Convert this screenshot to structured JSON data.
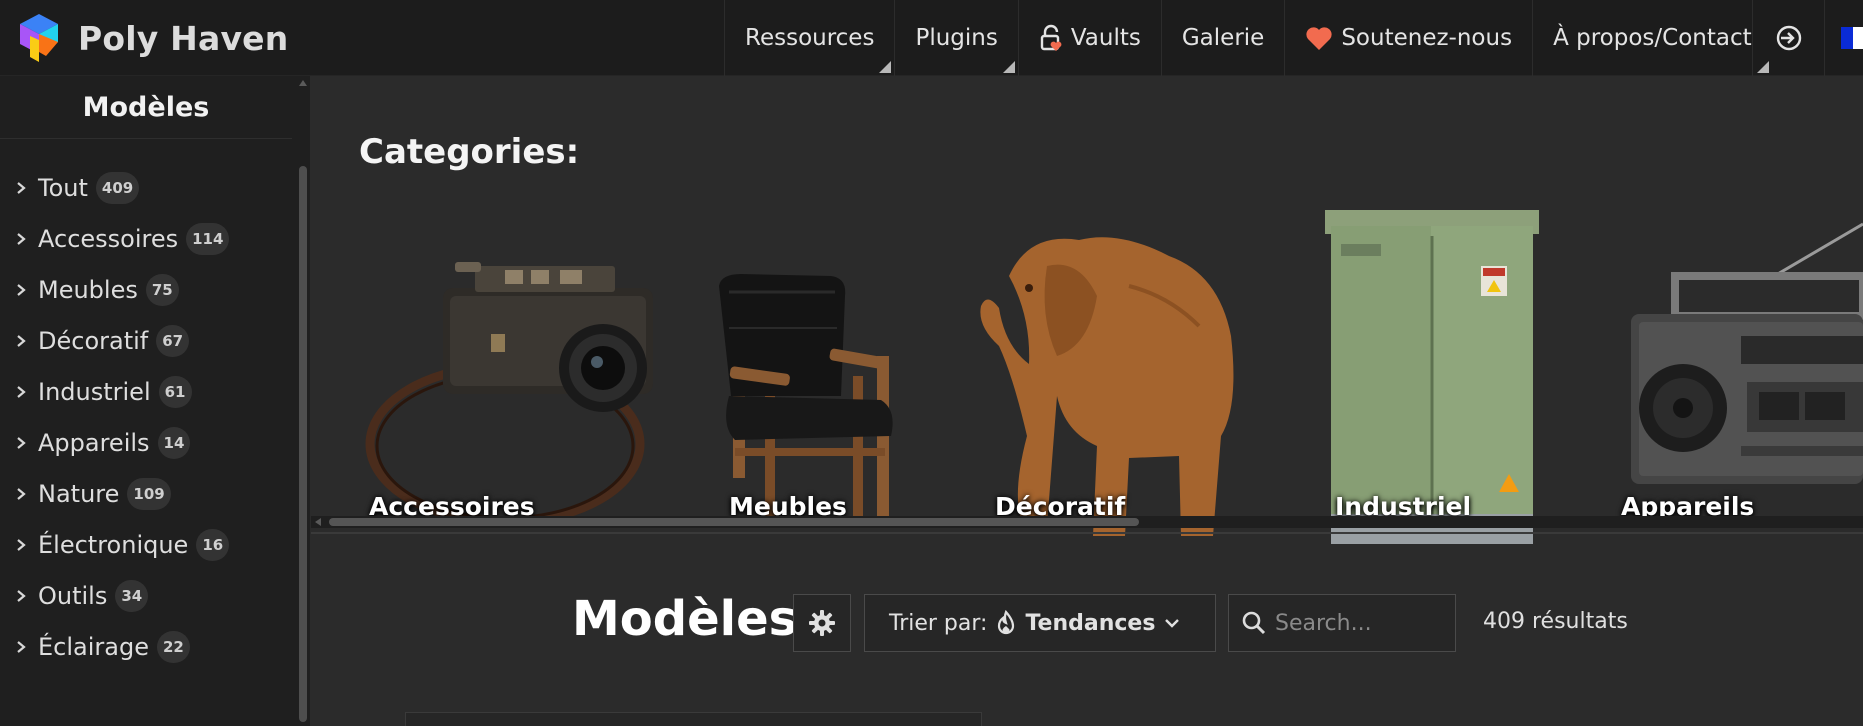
{
  "app": {
    "name": "Poly Haven"
  },
  "nav": {
    "items": [
      {
        "label": "Ressources",
        "icon": "",
        "dropdown": true
      },
      {
        "label": "Plugins",
        "icon": "",
        "dropdown": true
      },
      {
        "label": "Vaults",
        "icon": "lock-heart-icon",
        "dropdown": false
      },
      {
        "label": "Galerie",
        "icon": "",
        "dropdown": false
      },
      {
        "label": "Soutenez-nous",
        "icon": "heart-icon",
        "dropdown": false
      },
      {
        "label": "À propos/Contact",
        "icon": "",
        "dropdown": true
      }
    ],
    "login_icon": "login-icon",
    "language_icon": "flag-fr-icon"
  },
  "sidebar": {
    "title": "Modèles",
    "items": [
      {
        "label": "Tout",
        "count": "409"
      },
      {
        "label": "Accessoires",
        "count": "114"
      },
      {
        "label": "Meubles",
        "count": "75"
      },
      {
        "label": "Décoratif",
        "count": "67"
      },
      {
        "label": "Industriel",
        "count": "61"
      },
      {
        "label": "Appareils",
        "count": "14"
      },
      {
        "label": "Nature",
        "count": "109"
      },
      {
        "label": "Électronique",
        "count": "16"
      },
      {
        "label": "Outils",
        "count": "34"
      },
      {
        "label": "Éclairage",
        "count": "22"
      }
    ]
  },
  "categories": {
    "title": "Categories:",
    "cards": [
      {
        "label": "Accessoires",
        "image": "camera"
      },
      {
        "label": "Meubles",
        "image": "armchair"
      },
      {
        "label": "Décoratif",
        "image": "wooden-elephant"
      },
      {
        "label": "Industriel",
        "image": "electrical-cabinet"
      },
      {
        "label": "Appareils",
        "image": "boombox"
      }
    ]
  },
  "toolbar": {
    "title": "Modèles",
    "sort_label": "Trier par:",
    "sort_value": "Tendances",
    "search_placeholder": "Search...",
    "results": "409 résultats"
  },
  "colors": {
    "topbar": "#1c1c1c",
    "sidebar": "#1f1f1f",
    "main": "#2b2b2b",
    "heart": "#f26b4f",
    "flag_blue": "#0a2bd6",
    "flag_white": "#ffffff"
  }
}
